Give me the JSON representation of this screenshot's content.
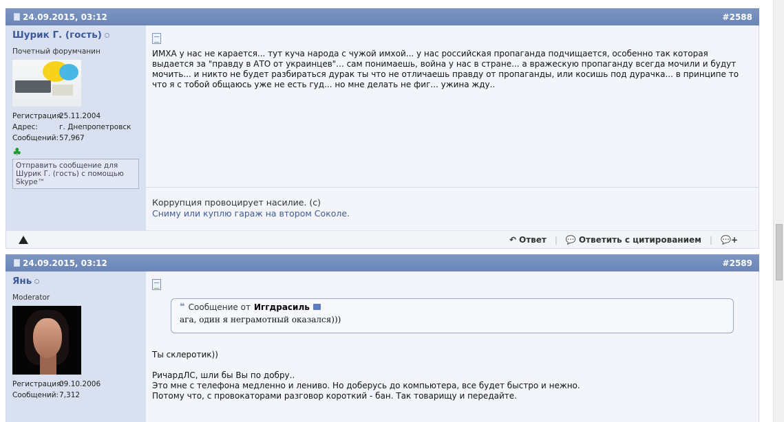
{
  "posts": [
    {
      "date": "24.09.2015, 03:12",
      "number": "#2588",
      "user": {
        "name": "Шурик Г. (гость)",
        "title": "Почетный форумчанин",
        "stats": [
          {
            "key": "Регистрация:",
            "value": "25.11.2004"
          },
          {
            "key": "Адрес:",
            "value": "г. Днепропетровск"
          },
          {
            "key": "Сообщений:",
            "value": "57,967"
          }
        ],
        "skype": "Отправить сообщение для Шурик Г. (гость) с помощью Skype™"
      },
      "text": "ИМХА у нас не карается... тут куча народа с чужой имхой... у нас российская пропаганда подчищается, особенно так которая выдается за \"правду в АТО от украинцев\"... сам понимаешь, война у нас в стране... а вражескую пропаганду всегда мочили и будут мочить... и никто не будет разбираться дурак ты что не отличаешь правду от пропаганды, или косишь под дурачка... в принципе то что я с тобой общаюсь уже не есть гуд... но мне делать не фиг... ужина жду..",
      "signature": {
        "line1": "Коррупция провоцирует насилие. (с)",
        "line2": "Сниму или куплю гараж на втором Соколе."
      },
      "actions": {
        "reply": "Ответ",
        "quote_reply": "Ответить с цитированием"
      }
    },
    {
      "date": "24.09.2015, 03:12",
      "number": "#2589",
      "user": {
        "name": "Янь",
        "title": "Moderator",
        "stats": [
          {
            "key": "Регистрация:",
            "value": "09.10.2006"
          },
          {
            "key": "Сообщений:",
            "value": "7,312"
          }
        ]
      },
      "quote": {
        "prefix": "Сообщение от",
        "author": "Иггдрасиль",
        "text": "ага, один я неграмотный оказался)))"
      },
      "lines": [
        "Ты склеротик))",
        "",
        "РичардЛС, шли бы Вы по добру..",
        "Это мне с телефона медленно и лениво. Но доберусь до компьютера, все будет быстро и нежно.",
        "Потому что, с провокаторами разговор короткий - бан. Так товарищу и передайте."
      ]
    }
  ]
}
